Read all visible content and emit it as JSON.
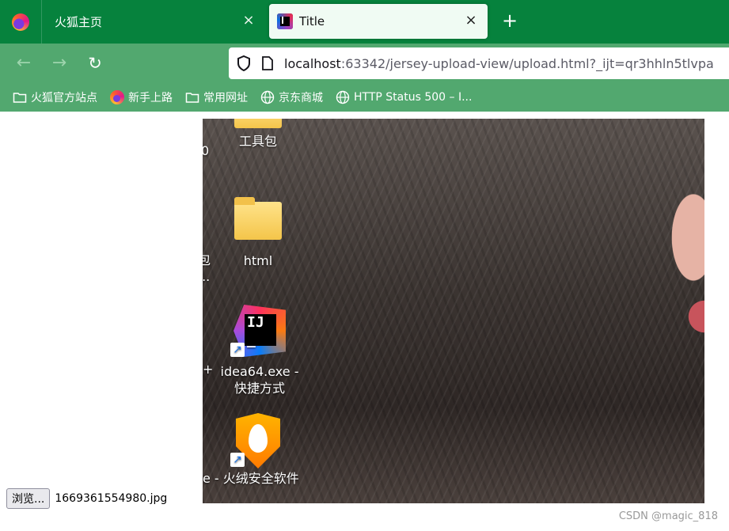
{
  "tabs": [
    {
      "label": "火狐主页",
      "active": false
    },
    {
      "label": "Title",
      "active": true
    }
  ],
  "toolbar": {
    "new_tab_glyph": "+",
    "close_glyph": "×",
    "back_glyph": "←",
    "forward_glyph": "→",
    "reload_glyph": "↻"
  },
  "urlbar": {
    "host": "localhost",
    "rest": ":63342/jersey-upload-view/upload.html?_ijt=qr3hhln5tlvpa"
  },
  "bookmarks": [
    {
      "label": "火狐官方站点",
      "icon": "folder-icon"
    },
    {
      "label": "新手上路",
      "icon": "firefox-icon"
    },
    {
      "label": "常用网址",
      "icon": "folder-icon"
    },
    {
      "label": "京东商城",
      "icon": "globe-icon"
    },
    {
      "label": "HTTP Status 500 – I...",
      "icon": "globe-icon"
    }
  ],
  "desktop_items": [
    {
      "label": "工具包",
      "prefix": "0"
    },
    {
      "label": "html",
      "prefix": "包"
    },
    {
      "label": "idea64.exe -",
      "label2": "快捷方式",
      "prefix": "+"
    },
    {
      "label": "e - 火绒安全软件"
    }
  ],
  "truncated_marker": "...",
  "file_input": {
    "button_label": "浏览...",
    "file_name": "1669361554980.jpg"
  },
  "watermark": "CSDN @magic_818",
  "colors": {
    "tabstrip": "#06823d",
    "toolbar": "#52a86f",
    "active_tab": "#f0fbf3"
  }
}
